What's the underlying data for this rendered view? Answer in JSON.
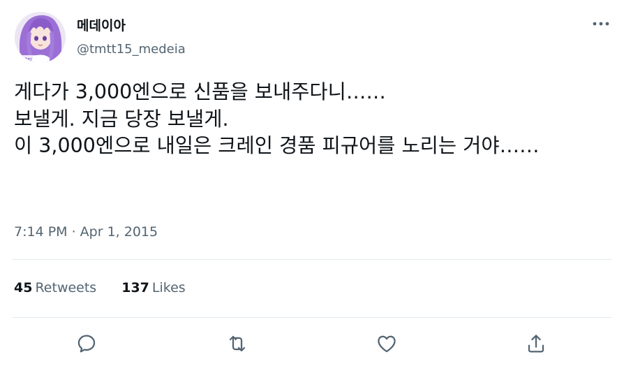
{
  "user": {
    "display_name": "메데이아",
    "handle": "@tmtt15_medeia"
  },
  "tweet": {
    "text": "게다가 3,000엔으로 신품을 보내주다니……\n보낼게. 지금 당장 보낼게.\n이 3,000엔으로 내일은 크레인 경품 피규어를 노리는 거야……",
    "timestamp": "7:14 PM · Apr 1, 2015"
  },
  "stats": {
    "retweets_count": "45",
    "retweets_label": "Retweets",
    "likes_count": "137",
    "likes_label": "Likes"
  },
  "more_label": "···",
  "icons": {
    "more": "more-horizontal-icon",
    "reply": "reply-icon",
    "retweet": "retweet-icon",
    "like": "heart-icon",
    "share": "share-icon"
  },
  "colors": {
    "text_primary": "#0f1419",
    "text_secondary": "#536471",
    "divider": "#e1e8ed",
    "avatar_hair": "#9b6fd6"
  }
}
